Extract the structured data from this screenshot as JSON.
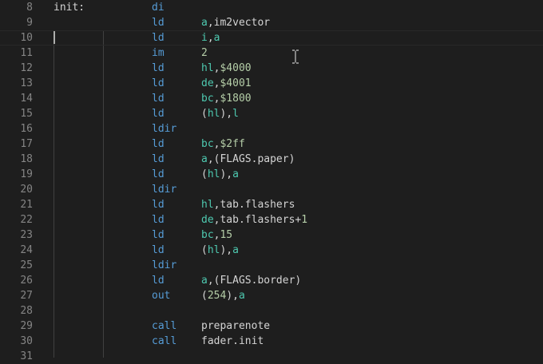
{
  "editor": {
    "colors": {
      "background": "#1e1e1e",
      "line_number": "#858585",
      "mnemonic": "#569cd6",
      "register": "#4ec9b0",
      "number": "#b5cea8",
      "symbol": "#d4d4d4"
    },
    "lines": [
      {
        "num": "8",
        "label": "init:",
        "mn": "di",
        "ops": []
      },
      {
        "num": "9",
        "label": "",
        "mn": "ld",
        "ops": [
          {
            "t": "reg",
            "v": "a"
          },
          {
            "t": "punc",
            "v": ","
          },
          {
            "t": "sym",
            "v": "im2vector"
          }
        ]
      },
      {
        "num": "10",
        "label": "",
        "mn": "ld",
        "ops": [
          {
            "t": "reg",
            "v": "i"
          },
          {
            "t": "punc",
            "v": ","
          },
          {
            "t": "reg",
            "v": "a"
          }
        ]
      },
      {
        "num": "11",
        "label": "",
        "mn": "im",
        "ops": [
          {
            "t": "num",
            "v": "2"
          }
        ]
      },
      {
        "num": "12",
        "label": "",
        "mn": "ld",
        "ops": [
          {
            "t": "reg",
            "v": "hl"
          },
          {
            "t": "punc",
            "v": ","
          },
          {
            "t": "num",
            "v": "$4000"
          }
        ]
      },
      {
        "num": "13",
        "label": "",
        "mn": "ld",
        "ops": [
          {
            "t": "reg",
            "v": "de"
          },
          {
            "t": "punc",
            "v": ","
          },
          {
            "t": "num",
            "v": "$4001"
          }
        ]
      },
      {
        "num": "14",
        "label": "",
        "mn": "ld",
        "ops": [
          {
            "t": "reg",
            "v": "bc"
          },
          {
            "t": "punc",
            "v": ","
          },
          {
            "t": "num",
            "v": "$1800"
          }
        ]
      },
      {
        "num": "15",
        "label": "",
        "mn": "ld",
        "ops": [
          {
            "t": "punc",
            "v": "("
          },
          {
            "t": "reg",
            "v": "hl"
          },
          {
            "t": "punc",
            "v": "),"
          },
          {
            "t": "reg",
            "v": "l"
          }
        ]
      },
      {
        "num": "16",
        "label": "",
        "mn": "ldir",
        "ops": []
      },
      {
        "num": "17",
        "label": "",
        "mn": "ld",
        "ops": [
          {
            "t": "reg",
            "v": "bc"
          },
          {
            "t": "punc",
            "v": ","
          },
          {
            "t": "num",
            "v": "$2ff"
          }
        ]
      },
      {
        "num": "18",
        "label": "",
        "mn": "ld",
        "ops": [
          {
            "t": "reg",
            "v": "a"
          },
          {
            "t": "punc",
            "v": ",("
          },
          {
            "t": "sym",
            "v": "FLAGS.paper"
          },
          {
            "t": "punc",
            "v": ")"
          }
        ]
      },
      {
        "num": "19",
        "label": "",
        "mn": "ld",
        "ops": [
          {
            "t": "punc",
            "v": "("
          },
          {
            "t": "reg",
            "v": "hl"
          },
          {
            "t": "punc",
            "v": "),"
          },
          {
            "t": "reg",
            "v": "a"
          }
        ]
      },
      {
        "num": "20",
        "label": "",
        "mn": "ldir",
        "ops": []
      },
      {
        "num": "21",
        "label": "",
        "mn": "ld",
        "ops": [
          {
            "t": "reg",
            "v": "hl"
          },
          {
            "t": "punc",
            "v": ","
          },
          {
            "t": "sym",
            "v": "tab.flashers"
          }
        ]
      },
      {
        "num": "22",
        "label": "",
        "mn": "ld",
        "ops": [
          {
            "t": "reg",
            "v": "de"
          },
          {
            "t": "punc",
            "v": ","
          },
          {
            "t": "sym",
            "v": "tab.flashers"
          },
          {
            "t": "punc",
            "v": "+"
          },
          {
            "t": "num",
            "v": "1"
          }
        ]
      },
      {
        "num": "23",
        "label": "",
        "mn": "ld",
        "ops": [
          {
            "t": "reg",
            "v": "bc"
          },
          {
            "t": "punc",
            "v": ","
          },
          {
            "t": "num",
            "v": "15"
          }
        ]
      },
      {
        "num": "24",
        "label": "",
        "mn": "ld",
        "ops": [
          {
            "t": "punc",
            "v": "("
          },
          {
            "t": "reg",
            "v": "hl"
          },
          {
            "t": "punc",
            "v": "),"
          },
          {
            "t": "reg",
            "v": "a"
          }
        ]
      },
      {
        "num": "25",
        "label": "",
        "mn": "ldir",
        "ops": []
      },
      {
        "num": "26",
        "label": "",
        "mn": "ld",
        "ops": [
          {
            "t": "reg",
            "v": "a"
          },
          {
            "t": "punc",
            "v": ",("
          },
          {
            "t": "sym",
            "v": "FLAGS.border"
          },
          {
            "t": "punc",
            "v": ")"
          }
        ]
      },
      {
        "num": "27",
        "label": "",
        "mn": "out",
        "ops": [
          {
            "t": "punc",
            "v": "("
          },
          {
            "t": "num",
            "v": "254"
          },
          {
            "t": "punc",
            "v": "),"
          },
          {
            "t": "reg",
            "v": "a"
          }
        ]
      },
      {
        "num": "28",
        "label": "",
        "mn": "",
        "ops": []
      },
      {
        "num": "29",
        "label": "",
        "mn": "call",
        "ops": [
          {
            "t": "sym",
            "v": "preparenote"
          }
        ]
      },
      {
        "num": "30",
        "label": "",
        "mn": "call",
        "ops": [
          {
            "t": "sym",
            "v": "fader.init"
          }
        ]
      },
      {
        "num": "31",
        "label": "",
        "mn": "",
        "ops": []
      }
    ]
  }
}
